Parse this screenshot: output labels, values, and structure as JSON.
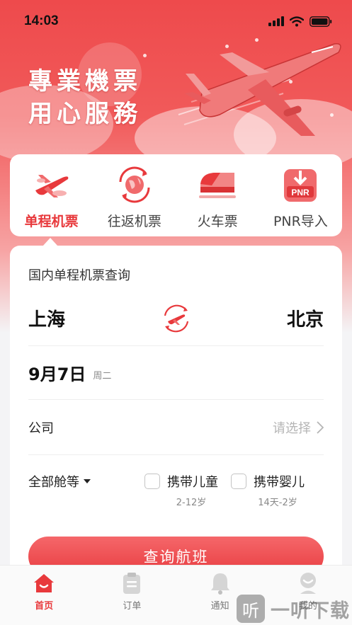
{
  "status": {
    "time": "14:03"
  },
  "hero": {
    "title_line1": "專業機票",
    "title_line2": "用心服務"
  },
  "ticket_types": [
    {
      "label": "单程机票",
      "icon": "plane-oneway-icon",
      "active": true
    },
    {
      "label": "往返机票",
      "icon": "globe-roundtrip-icon",
      "active": false
    },
    {
      "label": "火车票",
      "icon": "train-icon",
      "active": false
    },
    {
      "label": "PNR导入",
      "icon": "pnr-import-icon",
      "active": false
    }
  ],
  "search": {
    "title": "国内单程机票查询",
    "from_city": "上海",
    "to_city": "北京",
    "date": "9月7日",
    "weekday": "周二",
    "company_label": "公司",
    "company_placeholder": "请选择",
    "cabin_class": "全部舱等",
    "child": {
      "label": "携带儿童",
      "age": "2-12岁"
    },
    "infant": {
      "label": "携带婴儿",
      "age": "14天-2岁"
    },
    "submit_label": "查询航班"
  },
  "tabs": [
    {
      "label": "首页",
      "icon": "home-icon",
      "active": true
    },
    {
      "label": "订单",
      "icon": "clipboard-icon",
      "active": false
    },
    {
      "label": "通知",
      "icon": "bell-icon",
      "active": false
    },
    {
      "label": "我的",
      "icon": "user-icon",
      "active": false
    }
  ],
  "watermark": {
    "glyph": "听",
    "text": "一听下载"
  },
  "colors": {
    "accent": "#e8393c",
    "hero_top": "#ee4a4c"
  }
}
